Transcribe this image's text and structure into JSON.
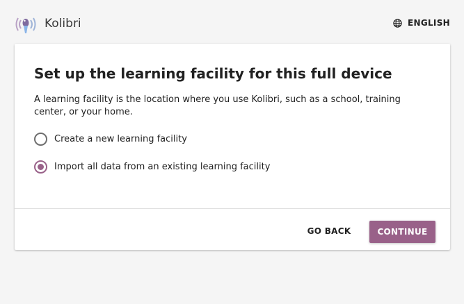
{
  "header": {
    "app_name": "Kolibri",
    "language_label": "ENGLISH"
  },
  "setup": {
    "title": "Set up the learning facility for this full device",
    "description": "A learning facility is the location where you use Kolibri, such as a school, training center, or your home.",
    "options": [
      {
        "label": "Create a new learning facility",
        "selected": false
      },
      {
        "label": "Import all data from an existing learning facility",
        "selected": true
      }
    ],
    "back_label": "GO BACK",
    "continue_label": "CONTINUE"
  },
  "colors": {
    "accent": "#996189",
    "background": "#f5f5f5"
  },
  "icons": {
    "logo": "kolibri-logo-icon",
    "language": "globe-icon"
  }
}
